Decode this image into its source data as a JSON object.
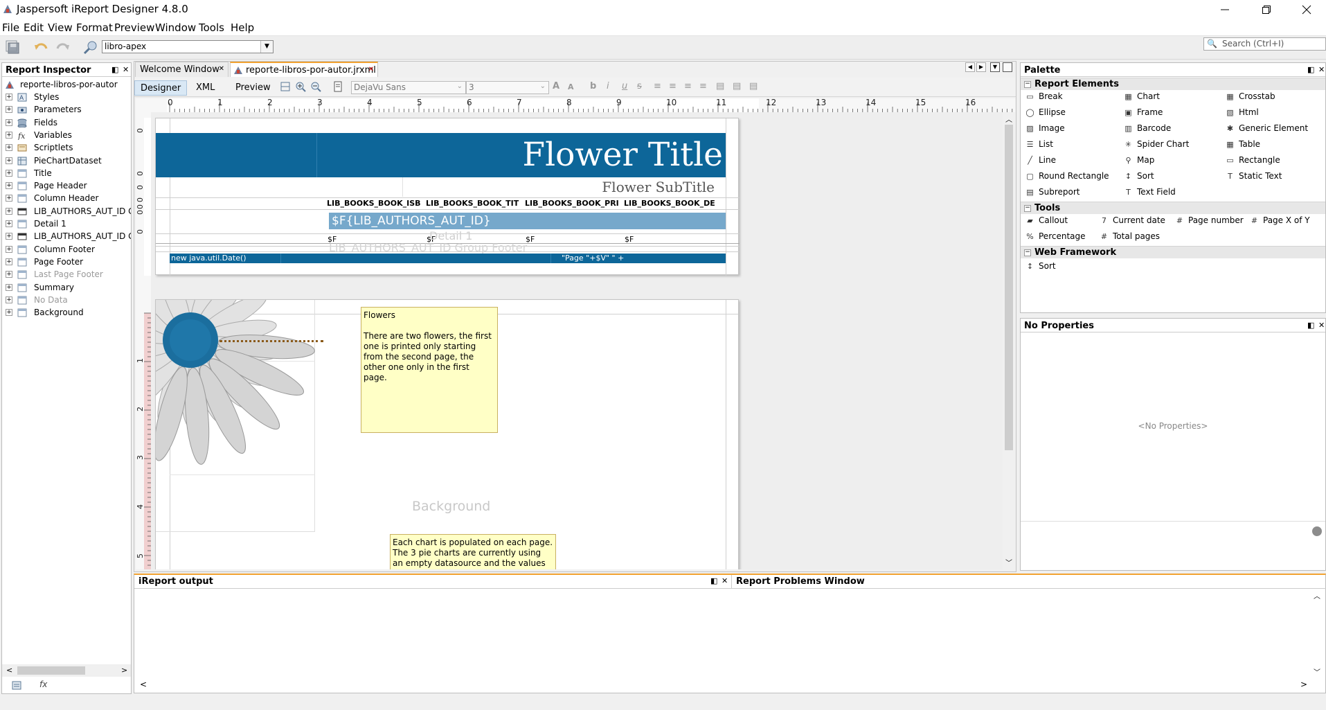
{
  "app": {
    "title": "Jaspersoft iReport Designer 4.8.0",
    "menu": [
      "File",
      "Edit",
      "View",
      "Format",
      "Preview",
      "Window",
      "Tools",
      "Help"
    ],
    "datasource": "libro-apex",
    "search_placeholder": "Search (Ctrl+I)"
  },
  "inspector": {
    "title": "Report Inspector",
    "root": "reporte-libros-por-autor",
    "items": [
      {
        "label": "Styles",
        "icon": "styles-icon",
        "dim": false
      },
      {
        "label": "Parameters",
        "icon": "parameters-icon",
        "dim": false
      },
      {
        "label": "Fields",
        "icon": "fields-icon",
        "dim": false
      },
      {
        "label": "Variables",
        "icon": "variables-icon",
        "dim": false
      },
      {
        "label": "Scriptlets",
        "icon": "scriptlets-icon",
        "dim": false
      },
      {
        "label": "PieChartDataset",
        "icon": "dataset-icon",
        "dim": false
      },
      {
        "label": "Title",
        "icon": "band-icon",
        "dim": false
      },
      {
        "label": "Page Header",
        "icon": "band-icon",
        "dim": false
      },
      {
        "label": "Column Header",
        "icon": "band-icon",
        "dim": false
      },
      {
        "label": "LIB_AUTHORS_AUT_ID G",
        "icon": "group-band-icon",
        "dim": false
      },
      {
        "label": "Detail 1",
        "icon": "band-icon",
        "dim": false
      },
      {
        "label": "LIB_AUTHORS_AUT_ID G",
        "icon": "group-band-icon",
        "dim": false
      },
      {
        "label": "Column Footer",
        "icon": "band-icon",
        "dim": false
      },
      {
        "label": "Page Footer",
        "icon": "band-icon",
        "dim": false
      },
      {
        "label": "Last Page Footer",
        "icon": "band-icon",
        "dim": true
      },
      {
        "label": "Summary",
        "icon": "band-icon",
        "dim": false
      },
      {
        "label": "No Data",
        "icon": "band-icon",
        "dim": true
      },
      {
        "label": "Background",
        "icon": "band-icon",
        "dim": false
      }
    ]
  },
  "editor": {
    "tabs": [
      {
        "label": "Welcome Window",
        "active": false
      },
      {
        "label": "reporte-libros-por-autor.jrxml",
        "active": true
      }
    ],
    "subtabs": [
      "Designer",
      "XML",
      "Preview"
    ],
    "font_name": "DejaVu Sans",
    "font_size": "3",
    "ruler_numbers": [
      "0",
      "1",
      "2",
      "3",
      "4",
      "5",
      "6",
      "7",
      "8",
      "9",
      "10",
      "11",
      "12",
      "13",
      "14",
      "15",
      "16"
    ],
    "vruler_numbers": [
      "0",
      "0",
      "0",
      "0",
      "0",
      "0",
      "0",
      "1",
      "2",
      "3",
      "4",
      "5"
    ]
  },
  "report": {
    "title": "Flower Title",
    "subtitle": "Flower SubTitle",
    "columns": [
      "LIB_BOOKS_BOOK_ISB",
      "LIB_BOOKS_BOOK_TIT",
      "LIB_BOOKS_BOOK_PRI",
      "LIB_BOOKS_BOOK_DE"
    ],
    "group_field": "$F{LIB_AUTHORS_AUT_ID}",
    "detail_fields": [
      "$F",
      "$F",
      "$F",
      "$F"
    ],
    "ghost_detail": "Detail 1",
    "ghost_group_footer": "LIB_AUTHORS_AUT_ID Group Footer",
    "footer_date": "new java.util.Date()",
    "footer_page": "\"Page \"+$V\" \" +",
    "background_label": "Background",
    "note1_title": "Flowers",
    "note1_body": "There are two flowers, the first one is printed only starting from the second page, the other one only in the first page.",
    "note2_body": "Each chart is populated on each page. The 3 pie charts are currently using an empty datasource and the values are"
  },
  "palette": {
    "title": "Palette",
    "sections": {
      "report_elements": "Report Elements",
      "tools": "Tools",
      "web": "Web Framework"
    },
    "report_elements": [
      [
        "Break",
        "Chart",
        "Crosstab"
      ],
      [
        "Ellipse",
        "Frame",
        "Html"
      ],
      [
        "Image",
        "Barcode",
        "Generic Element"
      ],
      [
        "List",
        "Spider Chart",
        "Table"
      ],
      [
        "Line",
        "Map",
        "Rectangle"
      ],
      [
        "Round Rectangle",
        "Sort",
        "Static Text"
      ],
      [
        "Subreport",
        "Text Field",
        ""
      ]
    ],
    "report_element_icons": [
      [
        "break-icon",
        "chart-icon",
        "crosstab-icon"
      ],
      [
        "ellipse-icon",
        "frame-icon",
        "html-icon"
      ],
      [
        "image-icon",
        "barcode-icon",
        "generic-element-icon"
      ],
      [
        "list-icon",
        "spider-chart-icon",
        "table-icon"
      ],
      [
        "line-icon",
        "map-icon",
        "rectangle-icon"
      ],
      [
        "round-rectangle-icon",
        "sort-icon",
        "static-text-icon"
      ],
      [
        "subreport-icon",
        "text-field-icon",
        ""
      ]
    ],
    "tools": [
      [
        "Callout",
        "Current date",
        "Page number",
        "Page X of Y"
      ],
      [
        "Percentage",
        "Total pages",
        "",
        ""
      ]
    ],
    "web": [
      "Sort"
    ]
  },
  "properties": {
    "title": "No Properties",
    "empty": "<No Properties>"
  },
  "output": {
    "title": "iReport output",
    "problems": "Report Problems Window"
  },
  "colors": {
    "title_band": "#0d6699",
    "group_band": "#76a8cb",
    "footer_band": "#0d6699",
    "note": "#ffffc6",
    "active_subtab": "#d9e8f5"
  }
}
